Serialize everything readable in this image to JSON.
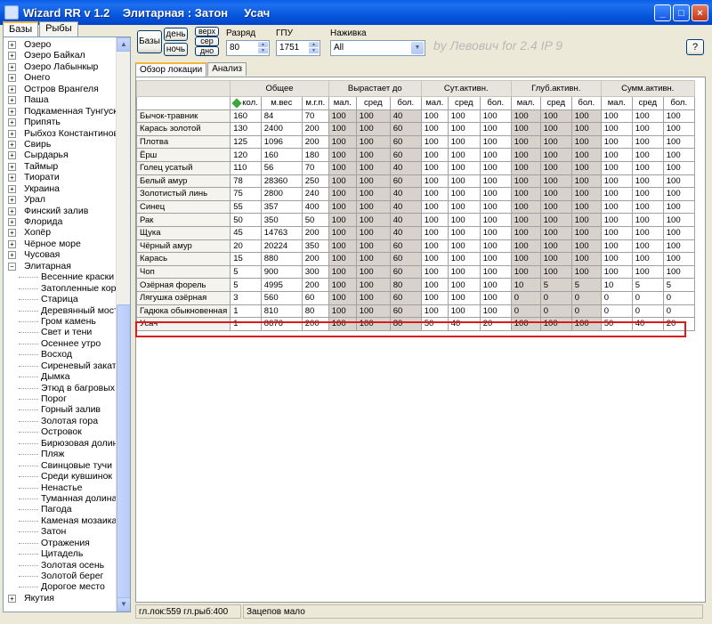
{
  "window": {
    "title": "Wizard RR v 1.2    Элитарная : Затон     Усач",
    "minimize": "_",
    "maximize": "□",
    "close": "×"
  },
  "left_tabs": [
    "Базы",
    "Рыбы"
  ],
  "tree": [
    {
      "label": "Озеро",
      "type": "node"
    },
    {
      "label": "Озеро Байкал",
      "type": "node"
    },
    {
      "label": "Озеро Лабынкыр",
      "type": "node"
    },
    {
      "label": "Онего",
      "type": "node"
    },
    {
      "label": "Остров Врангеля",
      "type": "node"
    },
    {
      "label": "Паша",
      "type": "node"
    },
    {
      "label": "Подкаменная Тунгуска",
      "type": "node"
    },
    {
      "label": "Припять",
      "type": "node"
    },
    {
      "label": "Рыбхоз Константиново",
      "type": "node"
    },
    {
      "label": "Свирь",
      "type": "node"
    },
    {
      "label": "Сырдарья",
      "type": "node"
    },
    {
      "label": "Таймыр",
      "type": "node"
    },
    {
      "label": "Тиорати",
      "type": "node"
    },
    {
      "label": "Украина",
      "type": "node"
    },
    {
      "label": "Урал",
      "type": "node"
    },
    {
      "label": "Финский залив",
      "type": "node"
    },
    {
      "label": "Флорида",
      "type": "node"
    },
    {
      "label": "Хопёр",
      "type": "node"
    },
    {
      "label": "Чёрное море",
      "type": "node"
    },
    {
      "label": "Чусовая",
      "type": "node"
    },
    {
      "label": "Элитарная",
      "type": "open"
    },
    {
      "label": "Весенние краски",
      "type": "child"
    },
    {
      "label": "Затопленные коряги",
      "type": "child"
    },
    {
      "label": "Старица",
      "type": "child"
    },
    {
      "label": "Деревянный мостик",
      "type": "child"
    },
    {
      "label": "Гром камень",
      "type": "child"
    },
    {
      "label": "Свет и тени",
      "type": "child"
    },
    {
      "label": "Осеннее утро",
      "type": "child"
    },
    {
      "label": "Восход",
      "type": "child"
    },
    {
      "label": "Сиреневый закат",
      "type": "child"
    },
    {
      "label": "Дымка",
      "type": "child"
    },
    {
      "label": "Этюд в багровых тон",
      "type": "child"
    },
    {
      "label": "Порог",
      "type": "child"
    },
    {
      "label": "Горный залив",
      "type": "child"
    },
    {
      "label": "Золотая гора",
      "type": "child"
    },
    {
      "label": "Островок",
      "type": "child"
    },
    {
      "label": "Бирюзовая долина",
      "type": "child"
    },
    {
      "label": "Пляж",
      "type": "child"
    },
    {
      "label": "Свинцовые тучи",
      "type": "child"
    },
    {
      "label": "Среди кувшинок",
      "type": "child"
    },
    {
      "label": "Ненастье",
      "type": "child"
    },
    {
      "label": "Туманная долина",
      "type": "child"
    },
    {
      "label": "Пагода",
      "type": "child"
    },
    {
      "label": "Каменая мозаика",
      "type": "child"
    },
    {
      "label": "Затон",
      "type": "child"
    },
    {
      "label": "Отражения",
      "type": "child"
    },
    {
      "label": "Цитадель",
      "type": "child"
    },
    {
      "label": "Золотая осень",
      "type": "child"
    },
    {
      "label": "Золотой берег",
      "type": "child"
    },
    {
      "label": "Дорогое место",
      "type": "child"
    },
    {
      "label": "Якутия",
      "type": "node"
    }
  ],
  "toolbar": {
    "bases_button": "Базы",
    "day_button": "день",
    "night_button": "ночь",
    "top_button": "верх",
    "mid_button": "сер",
    "bottom_button": "дно",
    "rank_label": "Разряд",
    "rank_value": "80",
    "gpu_label": "ГПУ",
    "gpu_value": "1751",
    "bait_label": "Наживка",
    "bait_value": "All",
    "watermark": "by Левович for 2.4 IP 9",
    "help_button": "?"
  },
  "content_tabs": [
    "Обзор локации",
    "Анализ"
  ],
  "table": {
    "groups": [
      "Общее",
      "Вырастает до",
      "Сут.активн.",
      "Глуб.активн.",
      "Сумм.активн."
    ],
    "subheaders": [
      "кол.",
      "м.вес",
      "м.г.п.",
      "мал.",
      "сред",
      "бол.",
      "мал.",
      "сред",
      "бол.",
      "мал.",
      "сред",
      "бол.",
      "мал.",
      "сред",
      "бол."
    ],
    "rows": [
      [
        "Бычок-травник",
        "160",
        "84",
        "70",
        "100",
        "100",
        "40",
        "100",
        "100",
        "100",
        "100",
        "100",
        "100",
        "100",
        "100",
        "100"
      ],
      [
        "Карась золотой",
        "130",
        "2400",
        "200",
        "100",
        "100",
        "60",
        "100",
        "100",
        "100",
        "100",
        "100",
        "100",
        "100",
        "100",
        "100"
      ],
      [
        "Плотва",
        "125",
        "1096",
        "200",
        "100",
        "100",
        "60",
        "100",
        "100",
        "100",
        "100",
        "100",
        "100",
        "100",
        "100",
        "100"
      ],
      [
        "Ёрш",
        "120",
        "160",
        "180",
        "100",
        "100",
        "60",
        "100",
        "100",
        "100",
        "100",
        "100",
        "100",
        "100",
        "100",
        "100"
      ],
      [
        "Голец усатый",
        "110",
        "56",
        "70",
        "100",
        "100",
        "40",
        "100",
        "100",
        "100",
        "100",
        "100",
        "100",
        "100",
        "100",
        "100"
      ],
      [
        "Белый амур",
        "78",
        "28360",
        "250",
        "100",
        "100",
        "60",
        "100",
        "100",
        "100",
        "100",
        "100",
        "100",
        "100",
        "100",
        "100"
      ],
      [
        "Золотистый линь",
        "75",
        "2800",
        "240",
        "100",
        "100",
        "40",
        "100",
        "100",
        "100",
        "100",
        "100",
        "100",
        "100",
        "100",
        "100"
      ],
      [
        "Синец",
        "55",
        "357",
        "400",
        "100",
        "100",
        "40",
        "100",
        "100",
        "100",
        "100",
        "100",
        "100",
        "100",
        "100",
        "100"
      ],
      [
        "Рак",
        "50",
        "350",
        "50",
        "100",
        "100",
        "40",
        "100",
        "100",
        "100",
        "100",
        "100",
        "100",
        "100",
        "100",
        "100"
      ],
      [
        "Щука",
        "45",
        "14763",
        "200",
        "100",
        "100",
        "40",
        "100",
        "100",
        "100",
        "100",
        "100",
        "100",
        "100",
        "100",
        "100"
      ],
      [
        "Чёрный амур",
        "20",
        "20224",
        "350",
        "100",
        "100",
        "60",
        "100",
        "100",
        "100",
        "100",
        "100",
        "100",
        "100",
        "100",
        "100"
      ],
      [
        "Карась",
        "15",
        "880",
        "200",
        "100",
        "100",
        "60",
        "100",
        "100",
        "100",
        "100",
        "100",
        "100",
        "100",
        "100",
        "100"
      ],
      [
        "Чоп",
        "5",
        "900",
        "300",
        "100",
        "100",
        "60",
        "100",
        "100",
        "100",
        "100",
        "100",
        "100",
        "100",
        "100",
        "100"
      ],
      [
        "Озёрная форель",
        "5",
        "4995",
        "200",
        "100",
        "100",
        "80",
        "100",
        "100",
        "100",
        "10",
        "5",
        "5",
        "10",
        "5",
        "5"
      ],
      [
        "Лягушка озёрная",
        "3",
        "560",
        "60",
        "100",
        "100",
        "60",
        "100",
        "100",
        "100",
        "0",
        "0",
        "0",
        "0",
        "0",
        "0"
      ],
      [
        "Гадюка обыкновенная",
        "1",
        "810",
        "80",
        "100",
        "100",
        "60",
        "100",
        "100",
        "100",
        "0",
        "0",
        "0",
        "0",
        "0",
        "0"
      ],
      [
        "Усач",
        "1",
        "8676",
        "200",
        "100",
        "100",
        "80",
        "50",
        "40",
        "20",
        "100",
        "100",
        "100",
        "50",
        "40",
        "20"
      ]
    ],
    "selected_row": 16
  },
  "status": {
    "counts": "гл.лок:559  гл.рыб:400",
    "message": "Зацепов мало"
  },
  "colors": {
    "titlebar": "#0a5ee8",
    "highlight_border": "#d81c1c",
    "shaded_cell": "#d8d2cc"
  }
}
